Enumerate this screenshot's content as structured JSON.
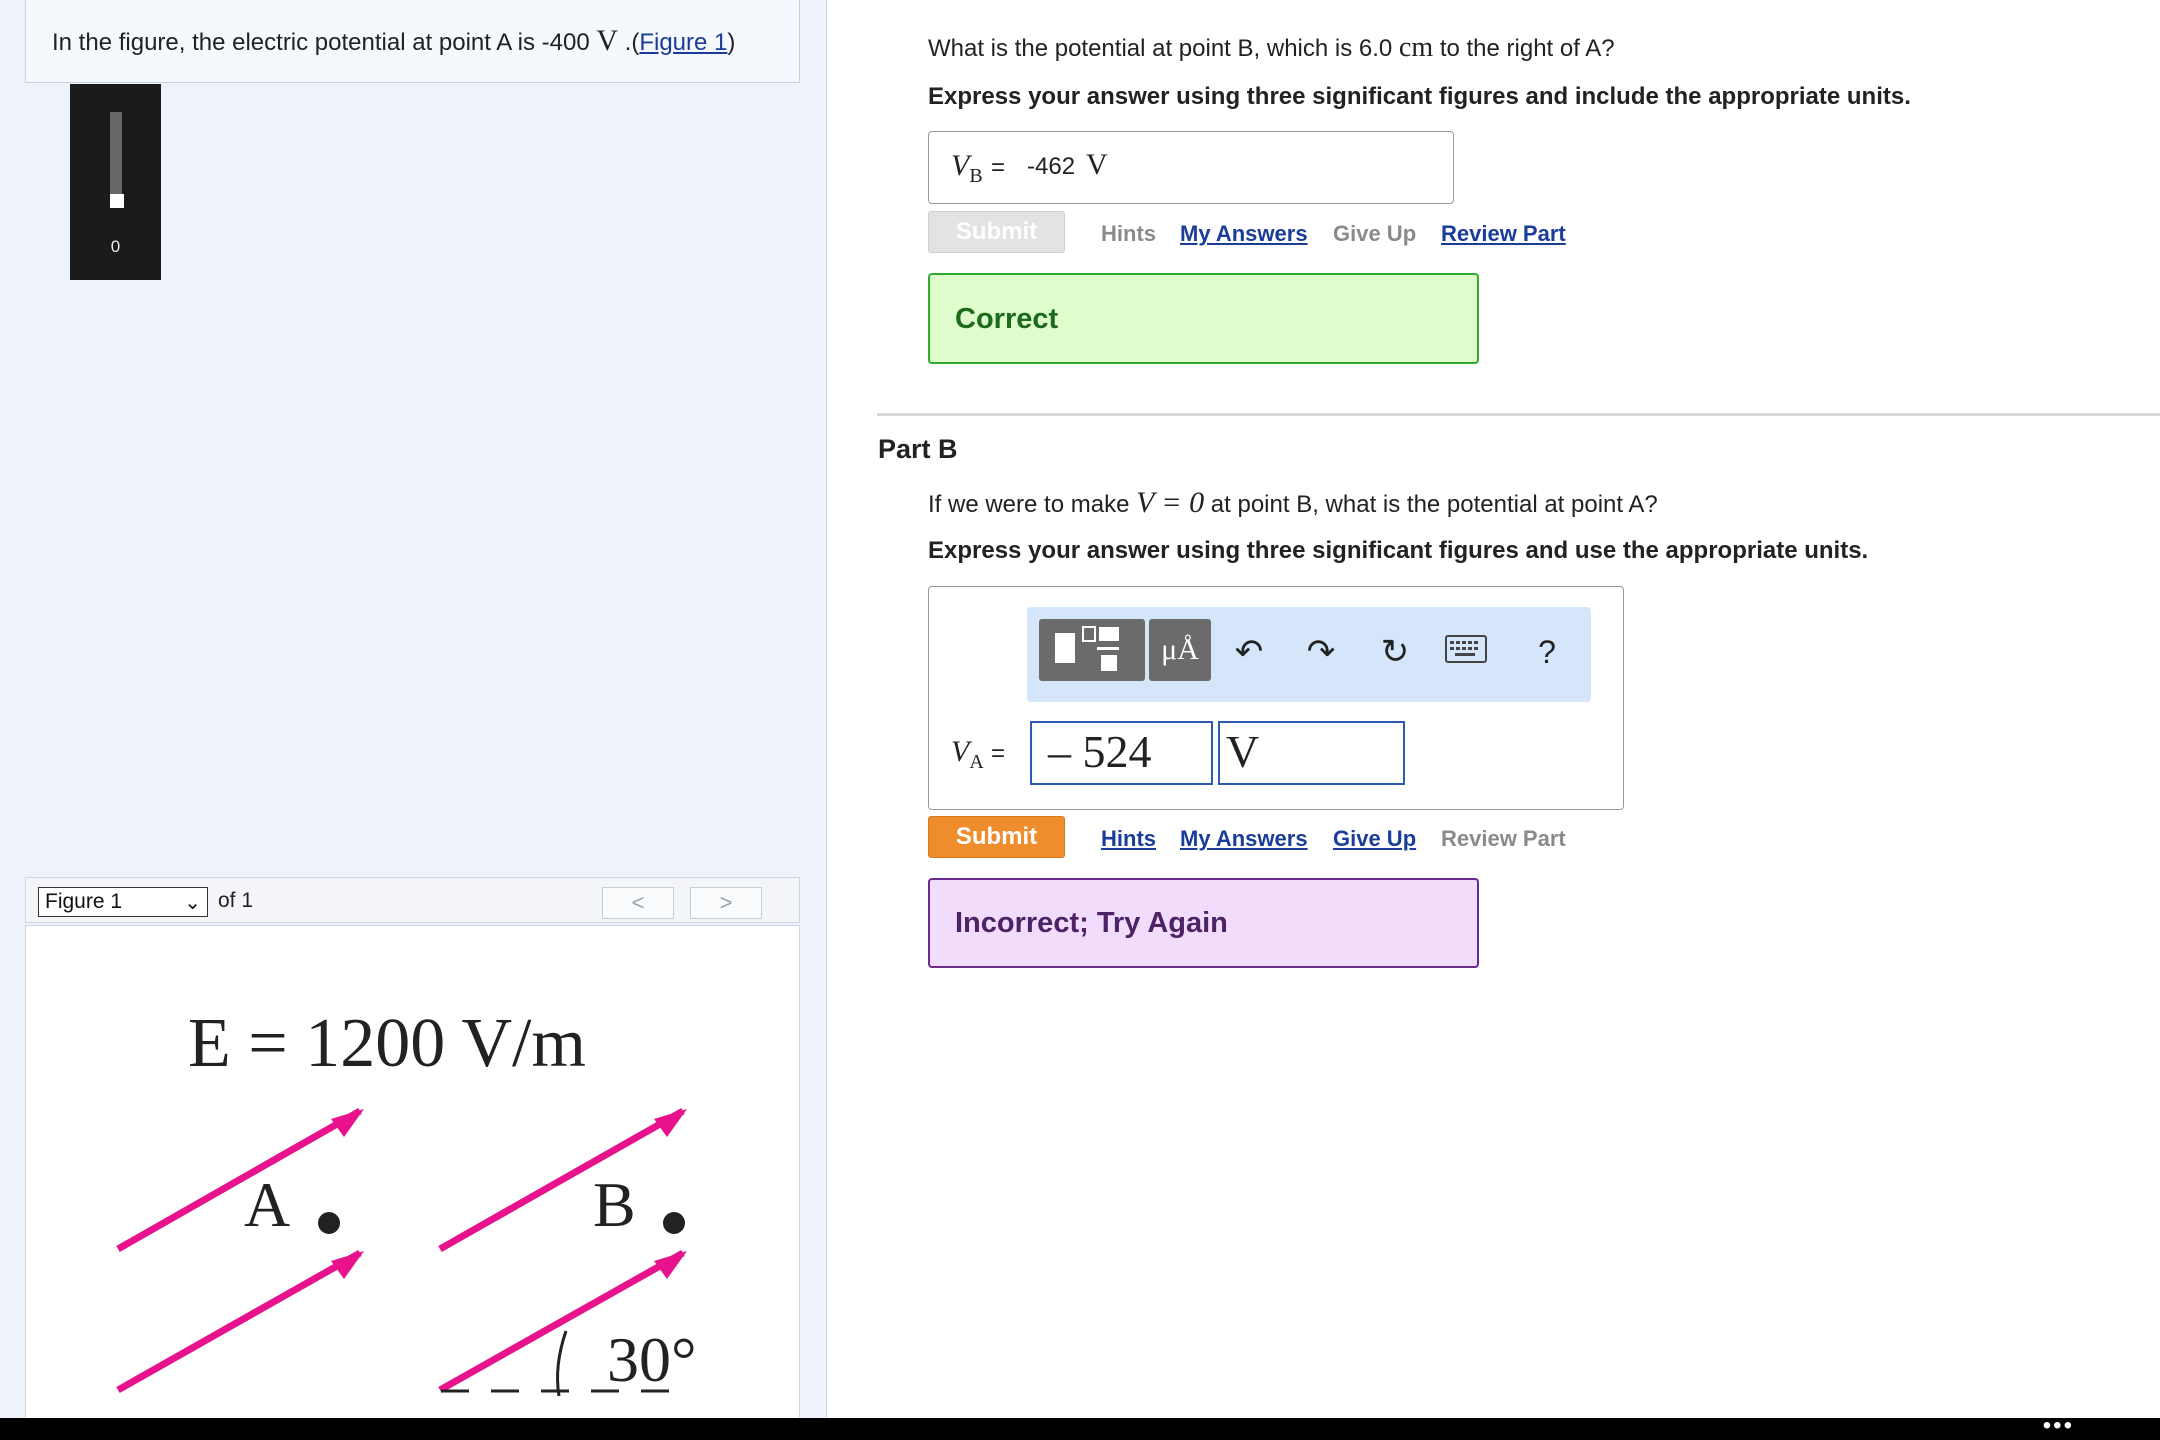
{
  "left": {
    "problem_prefix": "In the figure, the electric potential at point A is -400",
    "problem_unit": "V",
    "problem_mid": " .(",
    "figure_link": "Figure 1",
    "problem_suffix": ")",
    "slider_value": "0",
    "figure_toolbar": {
      "selected": "Figure 1",
      "of_label": "of 1",
      "prev": "<",
      "next": ">"
    },
    "figure": {
      "field_label": "E = 1200 V/m",
      "point_a": "A",
      "point_b": "B",
      "angle": "30°"
    }
  },
  "part_a": {
    "question_prefix": "What is the potential at point B, which is 6.0",
    "question_unit": "cm",
    "question_suffix": "to the right of A?",
    "instruction": "Express your answer using three significant figures and include the appropriate units.",
    "answer_label": "V",
    "answer_sub": "B",
    "answer_eq": "=",
    "answer_value": "-462",
    "answer_unit": "V",
    "submit": "Submit",
    "links": {
      "hints": "Hints",
      "my_answers": "My Answers",
      "give_up": "Give Up",
      "review": "Review Part"
    },
    "feedback": "Correct"
  },
  "part_b": {
    "title": "Part B",
    "question_prefix": "If we were to make",
    "question_math": "V = 0",
    "question_suffix": "at point B, what is the potential at point A?",
    "instruction": "Express your answer using three significant figures and use the appropriate units.",
    "toolbar": {
      "units": "μÅ",
      "undo": "↶",
      "redo": "↷",
      "reset": "↻",
      "keyboard": "⌨",
      "help": "?"
    },
    "answer_label": "V",
    "answer_sub": "A",
    "answer_eq": "=",
    "answer_value": "– 524",
    "answer_unit": "V",
    "submit": "Submit",
    "links": {
      "hints": "Hints",
      "my_answers": "My Answers",
      "give_up": "Give Up",
      "review": "Review Part"
    },
    "feedback": "Incorrect; Try Again"
  },
  "bottom_bar": {
    "more": "•••"
  },
  "colors": {
    "arrow": "#e8128c",
    "correct_bg": "#dffccc",
    "incorrect_bg": "#f2dcfb",
    "submit_active": "#ef8c2c",
    "link": "#1a3d99"
  }
}
